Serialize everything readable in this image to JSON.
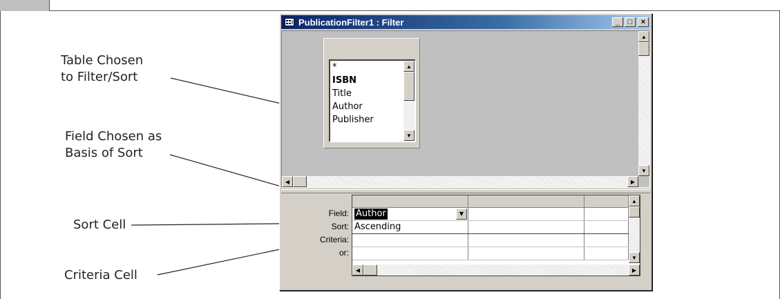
{
  "window": {
    "title": "PublicationFilter1 : Filter",
    "controls": {
      "minimize": "_",
      "maximize": "□",
      "close": "×"
    }
  },
  "field_list": {
    "items": [
      {
        "label": "*",
        "bold": false
      },
      {
        "label": "ISBN",
        "bold": true
      },
      {
        "label": "Title",
        "bold": false
      },
      {
        "label": "Author",
        "bold": false
      },
      {
        "label": "Publisher",
        "bold": false
      }
    ]
  },
  "grid": {
    "row_labels": {
      "field": "Field:",
      "sort": "Sort:",
      "criteria": "Criteria:",
      "or": "or:"
    },
    "columns": [
      {
        "field": "Author",
        "sort": "Ascending",
        "criteria": "",
        "or": ""
      },
      {
        "field": "",
        "sort": "",
        "criteria": "",
        "or": ""
      },
      {
        "field": "",
        "sort": "",
        "criteria": "",
        "or": ""
      }
    ]
  },
  "callouts": {
    "table_chosen": [
      "Table Chosen",
      "to Filter/Sort"
    ],
    "field_chosen": [
      "Field Chosen as",
      "Basis of Sort"
    ],
    "sort_cell": "Sort Cell",
    "criteria_cell": "Criteria Cell"
  },
  "colors": {
    "title_bar_start": "#0a246a",
    "title_bar_end": "#a6caf0",
    "window_face": "#d4d0c8",
    "pane_background": "#c0c0c0"
  }
}
